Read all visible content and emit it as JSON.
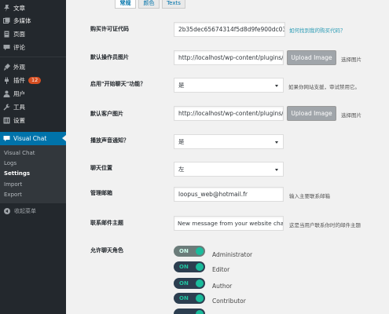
{
  "sidebar": {
    "items": [
      {
        "label": "文章",
        "icon": "pin-icon"
      },
      {
        "label": "多媒体",
        "icon": "media-icon"
      },
      {
        "label": "页面",
        "icon": "page-icon"
      },
      {
        "label": "评论",
        "icon": "comment-icon"
      },
      {
        "label": "外观",
        "icon": "appearance-icon"
      },
      {
        "label": "插件",
        "icon": "plugin-icon",
        "badge": "12"
      },
      {
        "label": "用户",
        "icon": "user-icon"
      },
      {
        "label": "工具",
        "icon": "wrench-icon"
      },
      {
        "label": "设置",
        "icon": "settings-icon"
      }
    ],
    "active": {
      "label": "Visual Chat",
      "icon": "chat-icon"
    },
    "submenu": [
      "Visual Chat",
      "Logs",
      "Settings",
      "Import",
      "Export"
    ],
    "current_sub": "Settings",
    "collapse_label": "收起菜单"
  },
  "tabs": [
    "常规",
    "颜色",
    "Texts"
  ],
  "form": {
    "purchase_code": {
      "label": "购买许可证代码",
      "value": "2b35dec65674314f5d8d9fe900dc03b8",
      "link": "如何找到我的购买代码？"
    },
    "operator_image": {
      "label": "默认操作员图片",
      "value": "http://localhost/wp-content/plugins/W",
      "button": "Upload Image",
      "desc": "选择图片"
    },
    "enable_start_chat": {
      "label": "启用\"开始聊天\"功能？",
      "value": "是",
      "desc": "如果你网站支援，审试禁用它。"
    },
    "customer_image": {
      "label": "默认客户图片",
      "value": "http://localhost/wp-content/plugins/W",
      "button": "Upload Image",
      "desc": "选择图片"
    },
    "sound_notification": {
      "label": "播放声音通知？",
      "value": "是"
    },
    "chat_position": {
      "label": "聊天位置",
      "value": "左"
    },
    "admin_email": {
      "label": "管理邮箱",
      "value": "loopus_web@hotmail.fr",
      "desc": "输入主要联系邮箱"
    },
    "email_subject": {
      "label": "联系邮件主题",
      "value": "New message from your website chat",
      "desc": "这是当用户联系你时的邮件主题"
    },
    "allowed_roles": {
      "label": "允许聊天角色",
      "toggle_label": "ON",
      "roles": [
        "Administrator",
        "Editor",
        "Author",
        "Contributor"
      ]
    }
  },
  "colors": {
    "sidebar_bg": "#23282d",
    "active_bg": "#0073aa",
    "toggle_accent": "#1abc9c",
    "link": "#2a9bb5"
  }
}
